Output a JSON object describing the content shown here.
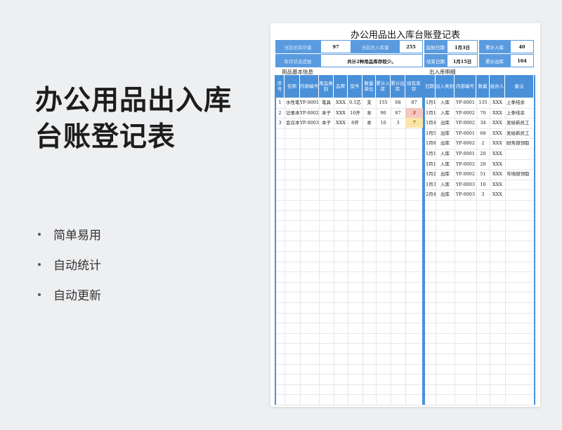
{
  "hero": {
    "title_line1": "办公用品出入库",
    "title_line2": "台账登记表"
  },
  "features": [
    "简单易用",
    "自动统计",
    "自动更新"
  ],
  "sheet": {
    "title": "办公用品出入库台账登记表",
    "summary": {
      "current_stock_label": "当前总库存量",
      "current_stock_value": "97",
      "current_in_label": "当前总入库量",
      "current_in_value": "255",
      "start_date_label": "起始日期",
      "start_date_value": "1月3日",
      "total_in_label": "累计入库",
      "total_in_value": "40",
      "stock_status_label": "库存状态提醒",
      "stock_status_value": "共计2种用品库存较少。",
      "end_date_label": "结束日期",
      "end_date_value": "1月15日",
      "total_out_label": "累计出库",
      "total_out_value": "104"
    },
    "left_section_title": "用品基本信息",
    "right_section_title": "出入库明细",
    "left_headers": [
      "序号",
      "名称",
      "内部编号",
      "用品类别",
      "品牌",
      "型号",
      "数量单位",
      "累计入库",
      "累计出库",
      "现有库存"
    ],
    "left_rows": [
      [
        "1",
        "水性笔",
        "YP-0001",
        "笔具",
        "XXX",
        "0.5芯",
        "支",
        "155",
        "68",
        "87"
      ],
      [
        "2",
        "记录本",
        "YP-0002",
        "本子",
        "XXX",
        "16开",
        "本",
        "90",
        "87",
        "3"
      ],
      [
        "3",
        "会议本",
        "YP-0003",
        "本子",
        "XXX",
        "8开",
        "本",
        "10",
        "3",
        "7"
      ]
    ],
    "right_headers": [
      "日期",
      "出入类别",
      "内部编号",
      "数量",
      "经办人",
      "备注"
    ],
    "right_rows": [
      [
        "1月1日",
        "入库",
        "YP-0001",
        "135",
        "XXX",
        "上季结余"
      ],
      [
        "1月1日",
        "入库",
        "YP-0002",
        "70",
        "XXX",
        "上季结余"
      ],
      [
        "1月4日",
        "出库",
        "YP-0002",
        "34",
        "XXX",
        "发给新员工"
      ],
      [
        "1月5日",
        "出库",
        "YP-0001",
        "68",
        "XXX",
        "发给新员工"
      ],
      [
        "1月8日",
        "出库",
        "YP-0002",
        "2",
        "XXX",
        "财务部领取"
      ],
      [
        "1月13日",
        "入库",
        "YP-0001",
        "20",
        "XXX",
        ""
      ],
      [
        "1月13日",
        "入库",
        "YP-0002",
        "20",
        "XXX",
        ""
      ],
      [
        "1月24日",
        "出库",
        "YP-0002",
        "51",
        "XXX",
        "市场部领取"
      ],
      [
        "1月30日",
        "入库",
        "YP-0003",
        "10",
        "XXX",
        ""
      ],
      [
        "2月4日",
        "出库",
        "YP-0003",
        "3",
        "XXX",
        ""
      ]
    ]
  }
}
